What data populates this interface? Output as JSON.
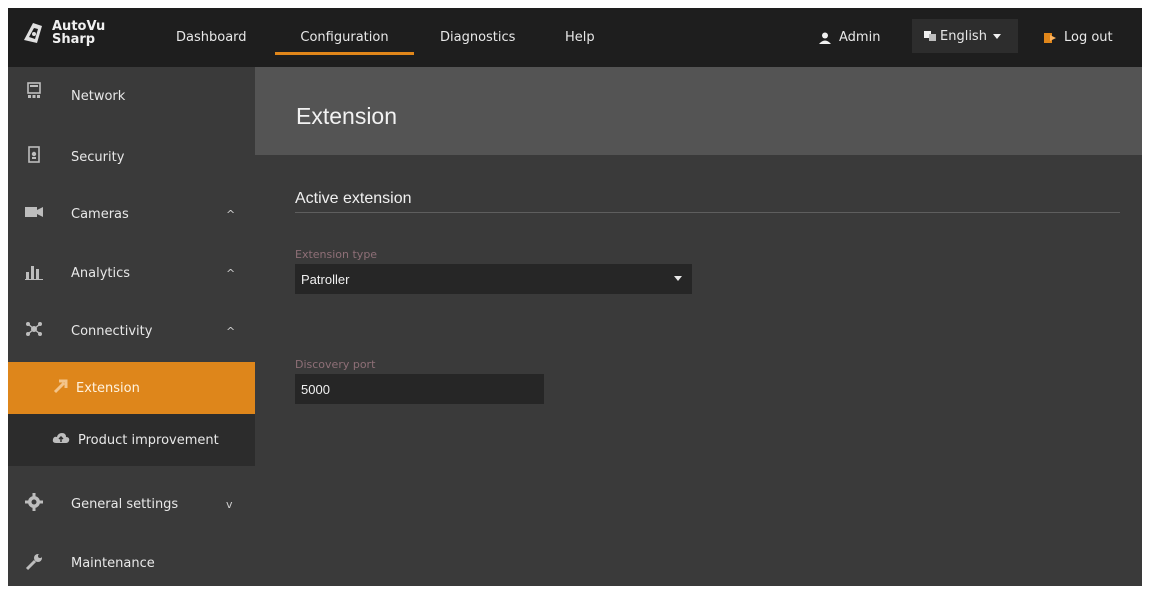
{
  "app": {
    "brand_line1": "AutoVu",
    "brand_line2": "Sharp"
  },
  "topnav": {
    "items": [
      {
        "label": "Dashboard",
        "active": false
      },
      {
        "label": "Configuration",
        "active": true
      },
      {
        "label": "Diagnostics",
        "active": false
      },
      {
        "label": "Help",
        "active": false
      }
    ],
    "user": {
      "label": "Admin",
      "icon": "user-icon"
    },
    "language": {
      "label": "English",
      "icon": "translate-icon"
    },
    "logout": {
      "label": "Log out",
      "icon": "logout-icon"
    }
  },
  "sidebar": {
    "items": [
      {
        "label": "Network",
        "icon": "network-icon"
      },
      {
        "label": "Security",
        "icon": "security-icon"
      },
      {
        "label": "Cameras",
        "icon": "camera-icon",
        "chevron": "up"
      },
      {
        "label": "Analytics",
        "icon": "analytics-icon",
        "chevron": "up"
      },
      {
        "label": "Connectivity",
        "icon": "connectivity-icon",
        "chevron": "up"
      },
      {
        "label": "Extension",
        "icon": "extension-icon",
        "active": true
      },
      {
        "label": "Product improvement",
        "icon": "cloud-icon"
      },
      {
        "label": "General settings",
        "icon": "gear-icon",
        "chevron": "down"
      },
      {
        "label": "Maintenance",
        "icon": "wrench-icon"
      }
    ]
  },
  "main": {
    "title": "Extension",
    "section": "Active extension",
    "fields": {
      "extension_type": {
        "label": "Extension type",
        "value": "Patroller"
      },
      "discovery_port": {
        "label": "Discovery port",
        "value": "5000"
      }
    }
  },
  "colors": {
    "accent": "#de861b",
    "topbar": "#1e1e1e",
    "sidebar": "#3a3a3a",
    "titlebar": "#545454"
  }
}
